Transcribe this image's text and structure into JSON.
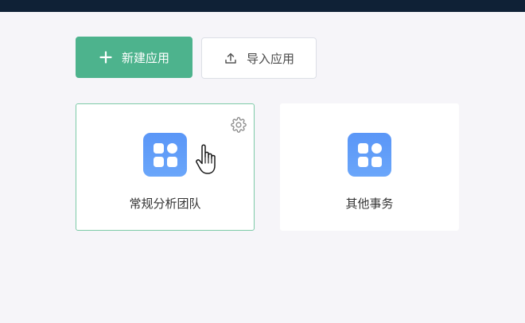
{
  "toolbar": {
    "new_app_label": "新建应用",
    "import_app_label": "导入应用"
  },
  "apps": [
    {
      "name": "常规分析团队",
      "selected": true
    },
    {
      "name": "其他事务",
      "selected": false
    }
  ],
  "colors": {
    "topbar": "#0f2136",
    "primary": "#4db38d",
    "background": "#f6f5f9",
    "app_icon": "#5a96f7",
    "selected_border": "#7dcaa8"
  },
  "icons": {
    "new_button": "plus-icon",
    "import_button": "upload-icon",
    "app": "grid-apps-icon",
    "settings": "gear-icon",
    "pointer": "hand-pointer-cursor"
  }
}
